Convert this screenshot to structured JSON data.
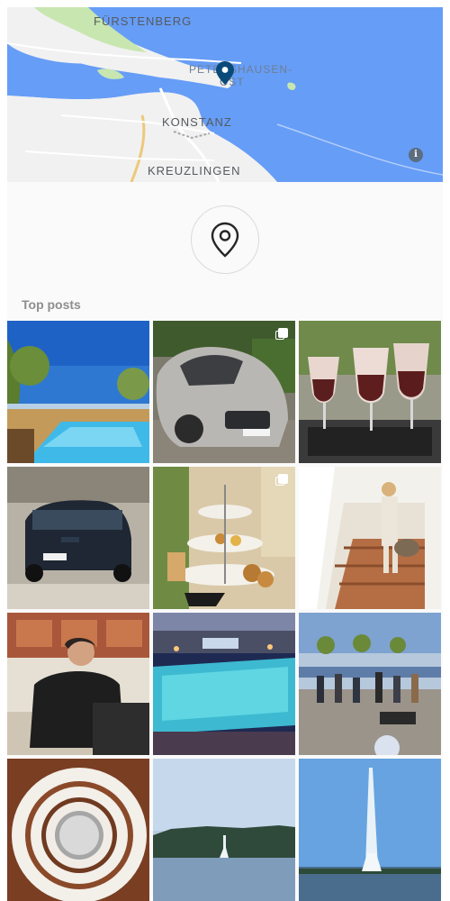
{
  "map": {
    "labels": {
      "furstenberg": "FÜRSTENBERG",
      "petershausen_1": "PETERSHAUSEN-",
      "petershausen_2": "OST",
      "konstanz": "KONSTANZ",
      "kreuzlingen": "KREUZLINGEN"
    },
    "info_icon": "info-icon",
    "info_glyph": "i",
    "pin_icon": "map-pin-icon",
    "colors": {
      "water": "#669df6",
      "land": "#f2f2f2",
      "park": "#c8e6b0",
      "road": "#e0c068",
      "pin": "#0a4a7a"
    }
  },
  "location": {
    "icon": "location-pin-icon",
    "section_title": "Top posts"
  },
  "posts": [
    {
      "name": "pool-terrace",
      "multi": false
    },
    {
      "name": "silver-mercedes",
      "multi": true
    },
    {
      "name": "champagne-glasses",
      "multi": false
    },
    {
      "name": "bmw-garage",
      "multi": false
    },
    {
      "name": "afternoon-tea",
      "multi": true
    },
    {
      "name": "woman-staircase",
      "multi": false
    },
    {
      "name": "man-laptop",
      "multi": false
    },
    {
      "name": "pool-evening",
      "multi": false
    },
    {
      "name": "lakeside-group",
      "multi": false
    },
    {
      "name": "spiral-staircase",
      "multi": false
    },
    {
      "name": "lake-fountain-far",
      "multi": false
    },
    {
      "name": "lake-fountain-near",
      "multi": false
    }
  ]
}
